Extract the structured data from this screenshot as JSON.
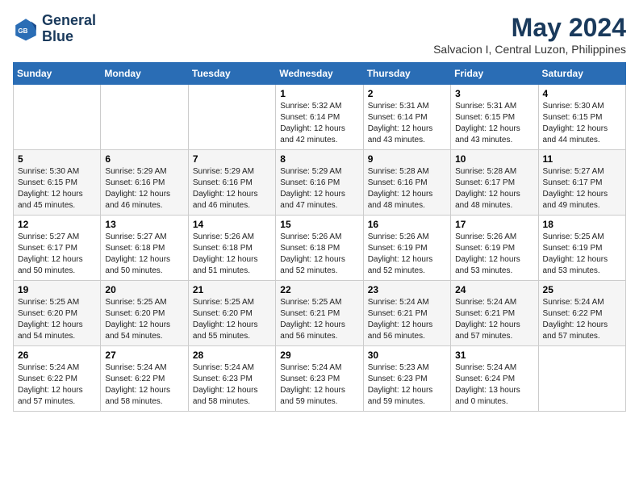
{
  "header": {
    "logo_line1": "General",
    "logo_line2": "Blue",
    "month": "May 2024",
    "location": "Salvacion I, Central Luzon, Philippines"
  },
  "weekdays": [
    "Sunday",
    "Monday",
    "Tuesday",
    "Wednesday",
    "Thursday",
    "Friday",
    "Saturday"
  ],
  "weeks": [
    [
      {
        "day": "",
        "info": ""
      },
      {
        "day": "",
        "info": ""
      },
      {
        "day": "",
        "info": ""
      },
      {
        "day": "1",
        "info": "Sunrise: 5:32 AM\nSunset: 6:14 PM\nDaylight: 12 hours\nand 42 minutes."
      },
      {
        "day": "2",
        "info": "Sunrise: 5:31 AM\nSunset: 6:14 PM\nDaylight: 12 hours\nand 43 minutes."
      },
      {
        "day": "3",
        "info": "Sunrise: 5:31 AM\nSunset: 6:15 PM\nDaylight: 12 hours\nand 43 minutes."
      },
      {
        "day": "4",
        "info": "Sunrise: 5:30 AM\nSunset: 6:15 PM\nDaylight: 12 hours\nand 44 minutes."
      }
    ],
    [
      {
        "day": "5",
        "info": "Sunrise: 5:30 AM\nSunset: 6:15 PM\nDaylight: 12 hours\nand 45 minutes."
      },
      {
        "day": "6",
        "info": "Sunrise: 5:29 AM\nSunset: 6:16 PM\nDaylight: 12 hours\nand 46 minutes."
      },
      {
        "day": "7",
        "info": "Sunrise: 5:29 AM\nSunset: 6:16 PM\nDaylight: 12 hours\nand 46 minutes."
      },
      {
        "day": "8",
        "info": "Sunrise: 5:29 AM\nSunset: 6:16 PM\nDaylight: 12 hours\nand 47 minutes."
      },
      {
        "day": "9",
        "info": "Sunrise: 5:28 AM\nSunset: 6:16 PM\nDaylight: 12 hours\nand 48 minutes."
      },
      {
        "day": "10",
        "info": "Sunrise: 5:28 AM\nSunset: 6:17 PM\nDaylight: 12 hours\nand 48 minutes."
      },
      {
        "day": "11",
        "info": "Sunrise: 5:27 AM\nSunset: 6:17 PM\nDaylight: 12 hours\nand 49 minutes."
      }
    ],
    [
      {
        "day": "12",
        "info": "Sunrise: 5:27 AM\nSunset: 6:17 PM\nDaylight: 12 hours\nand 50 minutes."
      },
      {
        "day": "13",
        "info": "Sunrise: 5:27 AM\nSunset: 6:18 PM\nDaylight: 12 hours\nand 50 minutes."
      },
      {
        "day": "14",
        "info": "Sunrise: 5:26 AM\nSunset: 6:18 PM\nDaylight: 12 hours\nand 51 minutes."
      },
      {
        "day": "15",
        "info": "Sunrise: 5:26 AM\nSunset: 6:18 PM\nDaylight: 12 hours\nand 52 minutes."
      },
      {
        "day": "16",
        "info": "Sunrise: 5:26 AM\nSunset: 6:19 PM\nDaylight: 12 hours\nand 52 minutes."
      },
      {
        "day": "17",
        "info": "Sunrise: 5:26 AM\nSunset: 6:19 PM\nDaylight: 12 hours\nand 53 minutes."
      },
      {
        "day": "18",
        "info": "Sunrise: 5:25 AM\nSunset: 6:19 PM\nDaylight: 12 hours\nand 53 minutes."
      }
    ],
    [
      {
        "day": "19",
        "info": "Sunrise: 5:25 AM\nSunset: 6:20 PM\nDaylight: 12 hours\nand 54 minutes."
      },
      {
        "day": "20",
        "info": "Sunrise: 5:25 AM\nSunset: 6:20 PM\nDaylight: 12 hours\nand 54 minutes."
      },
      {
        "day": "21",
        "info": "Sunrise: 5:25 AM\nSunset: 6:20 PM\nDaylight: 12 hours\nand 55 minutes."
      },
      {
        "day": "22",
        "info": "Sunrise: 5:25 AM\nSunset: 6:21 PM\nDaylight: 12 hours\nand 56 minutes."
      },
      {
        "day": "23",
        "info": "Sunrise: 5:24 AM\nSunset: 6:21 PM\nDaylight: 12 hours\nand 56 minutes."
      },
      {
        "day": "24",
        "info": "Sunrise: 5:24 AM\nSunset: 6:21 PM\nDaylight: 12 hours\nand 57 minutes."
      },
      {
        "day": "25",
        "info": "Sunrise: 5:24 AM\nSunset: 6:22 PM\nDaylight: 12 hours\nand 57 minutes."
      }
    ],
    [
      {
        "day": "26",
        "info": "Sunrise: 5:24 AM\nSunset: 6:22 PM\nDaylight: 12 hours\nand 57 minutes."
      },
      {
        "day": "27",
        "info": "Sunrise: 5:24 AM\nSunset: 6:22 PM\nDaylight: 12 hours\nand 58 minutes."
      },
      {
        "day": "28",
        "info": "Sunrise: 5:24 AM\nSunset: 6:23 PM\nDaylight: 12 hours\nand 58 minutes."
      },
      {
        "day": "29",
        "info": "Sunrise: 5:24 AM\nSunset: 6:23 PM\nDaylight: 12 hours\nand 59 minutes."
      },
      {
        "day": "30",
        "info": "Sunrise: 5:23 AM\nSunset: 6:23 PM\nDaylight: 12 hours\nand 59 minutes."
      },
      {
        "day": "31",
        "info": "Sunrise: 5:24 AM\nSunset: 6:24 PM\nDaylight: 13 hours\nand 0 minutes."
      },
      {
        "day": "",
        "info": ""
      }
    ]
  ]
}
